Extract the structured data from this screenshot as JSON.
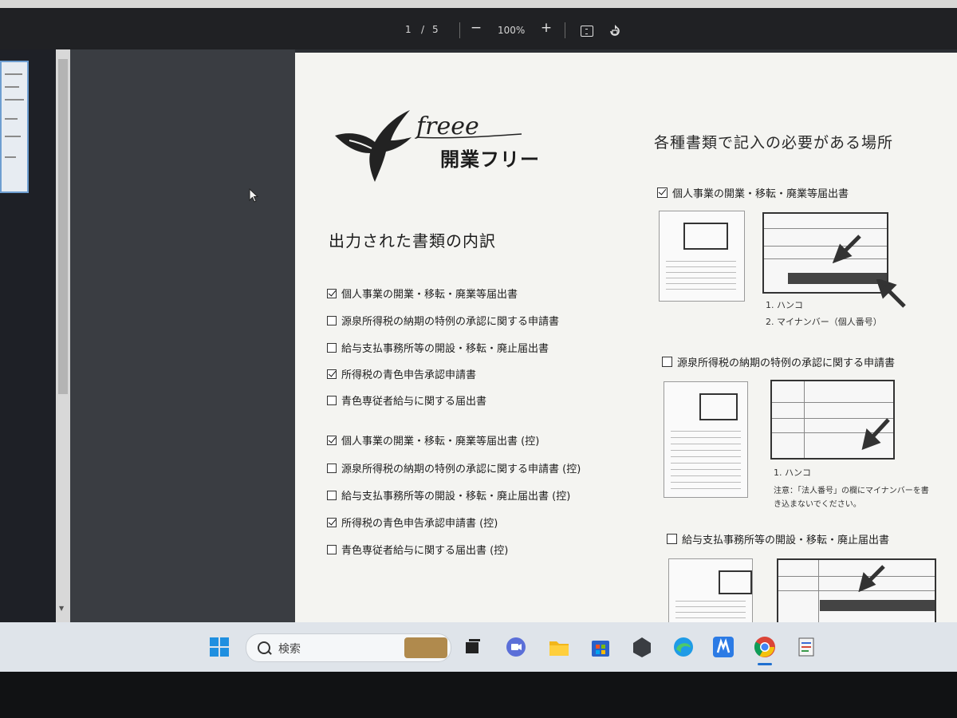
{
  "viewer": {
    "page_current": "1",
    "page_sep": "/",
    "page_total": "5",
    "zoom_out": "−",
    "zoom": "100%",
    "zoom_in": "+"
  },
  "document": {
    "logo_script": "freee",
    "logo_title": "開業フリー",
    "section_title": "出力された書類の内訳",
    "checklist": [
      {
        "label": "個人事業の開業・移転・廃業等届出書",
        "checked": true
      },
      {
        "label": "源泉所得税の納期の特例の承認に関する申請書",
        "checked": false
      },
      {
        "label": "給与支払事務所等の開設・移転・廃止届出書",
        "checked": false
      },
      {
        "label": "所得税の青色申告承認申請書",
        "checked": true
      },
      {
        "label": "青色専従者給与に関する届出書",
        "checked": false
      },
      {
        "label": "個人事業の開業・移転・廃業等届出書 (控)",
        "checked": true
      },
      {
        "label": "源泉所得税の納期の特例の承認に関する申請書 (控)",
        "checked": false
      },
      {
        "label": "給与支払事務所等の開設・移転・廃止届出書 (控)",
        "checked": false
      },
      {
        "label": "所得税の青色申告承認申請書 (控)",
        "checked": true
      },
      {
        "label": "青色専従者給与に関する届出書 (控)",
        "checked": false
      }
    ],
    "right_title": "各種書類で記入の必要がある場所",
    "sections": [
      {
        "label": "個人事業の開業・移転・廃業等届出書",
        "checked": true,
        "notes": [
          "1. ハンコ",
          "2. マイナンバー（個人番号）"
        ]
      },
      {
        "label": "源泉所得税の納期の特例の承認に関する申請書",
        "checked": false,
        "notes": [
          "1. ハンコ",
          "注意：「法人番号」の欄にマイナンバーを書",
          "き込まないでください。"
        ]
      },
      {
        "label": "給与支払事務所等の開設・移転・廃止届出書",
        "checked": false,
        "notes": []
      }
    ]
  },
  "taskbar": {
    "search_label": "検索",
    "apps": [
      "start-icon",
      "task-view-icon",
      "chat-icon",
      "file-explorer-icon",
      "store-icon",
      "app-icon",
      "edge-icon",
      "ma-app-icon",
      "chrome-icon",
      "notepad-app-icon"
    ]
  },
  "colors": {
    "taskbar": "#dfe4ea",
    "toolbar": "#202124",
    "page": "#f4f4f1",
    "thumb_border": "#6e9ed1"
  }
}
